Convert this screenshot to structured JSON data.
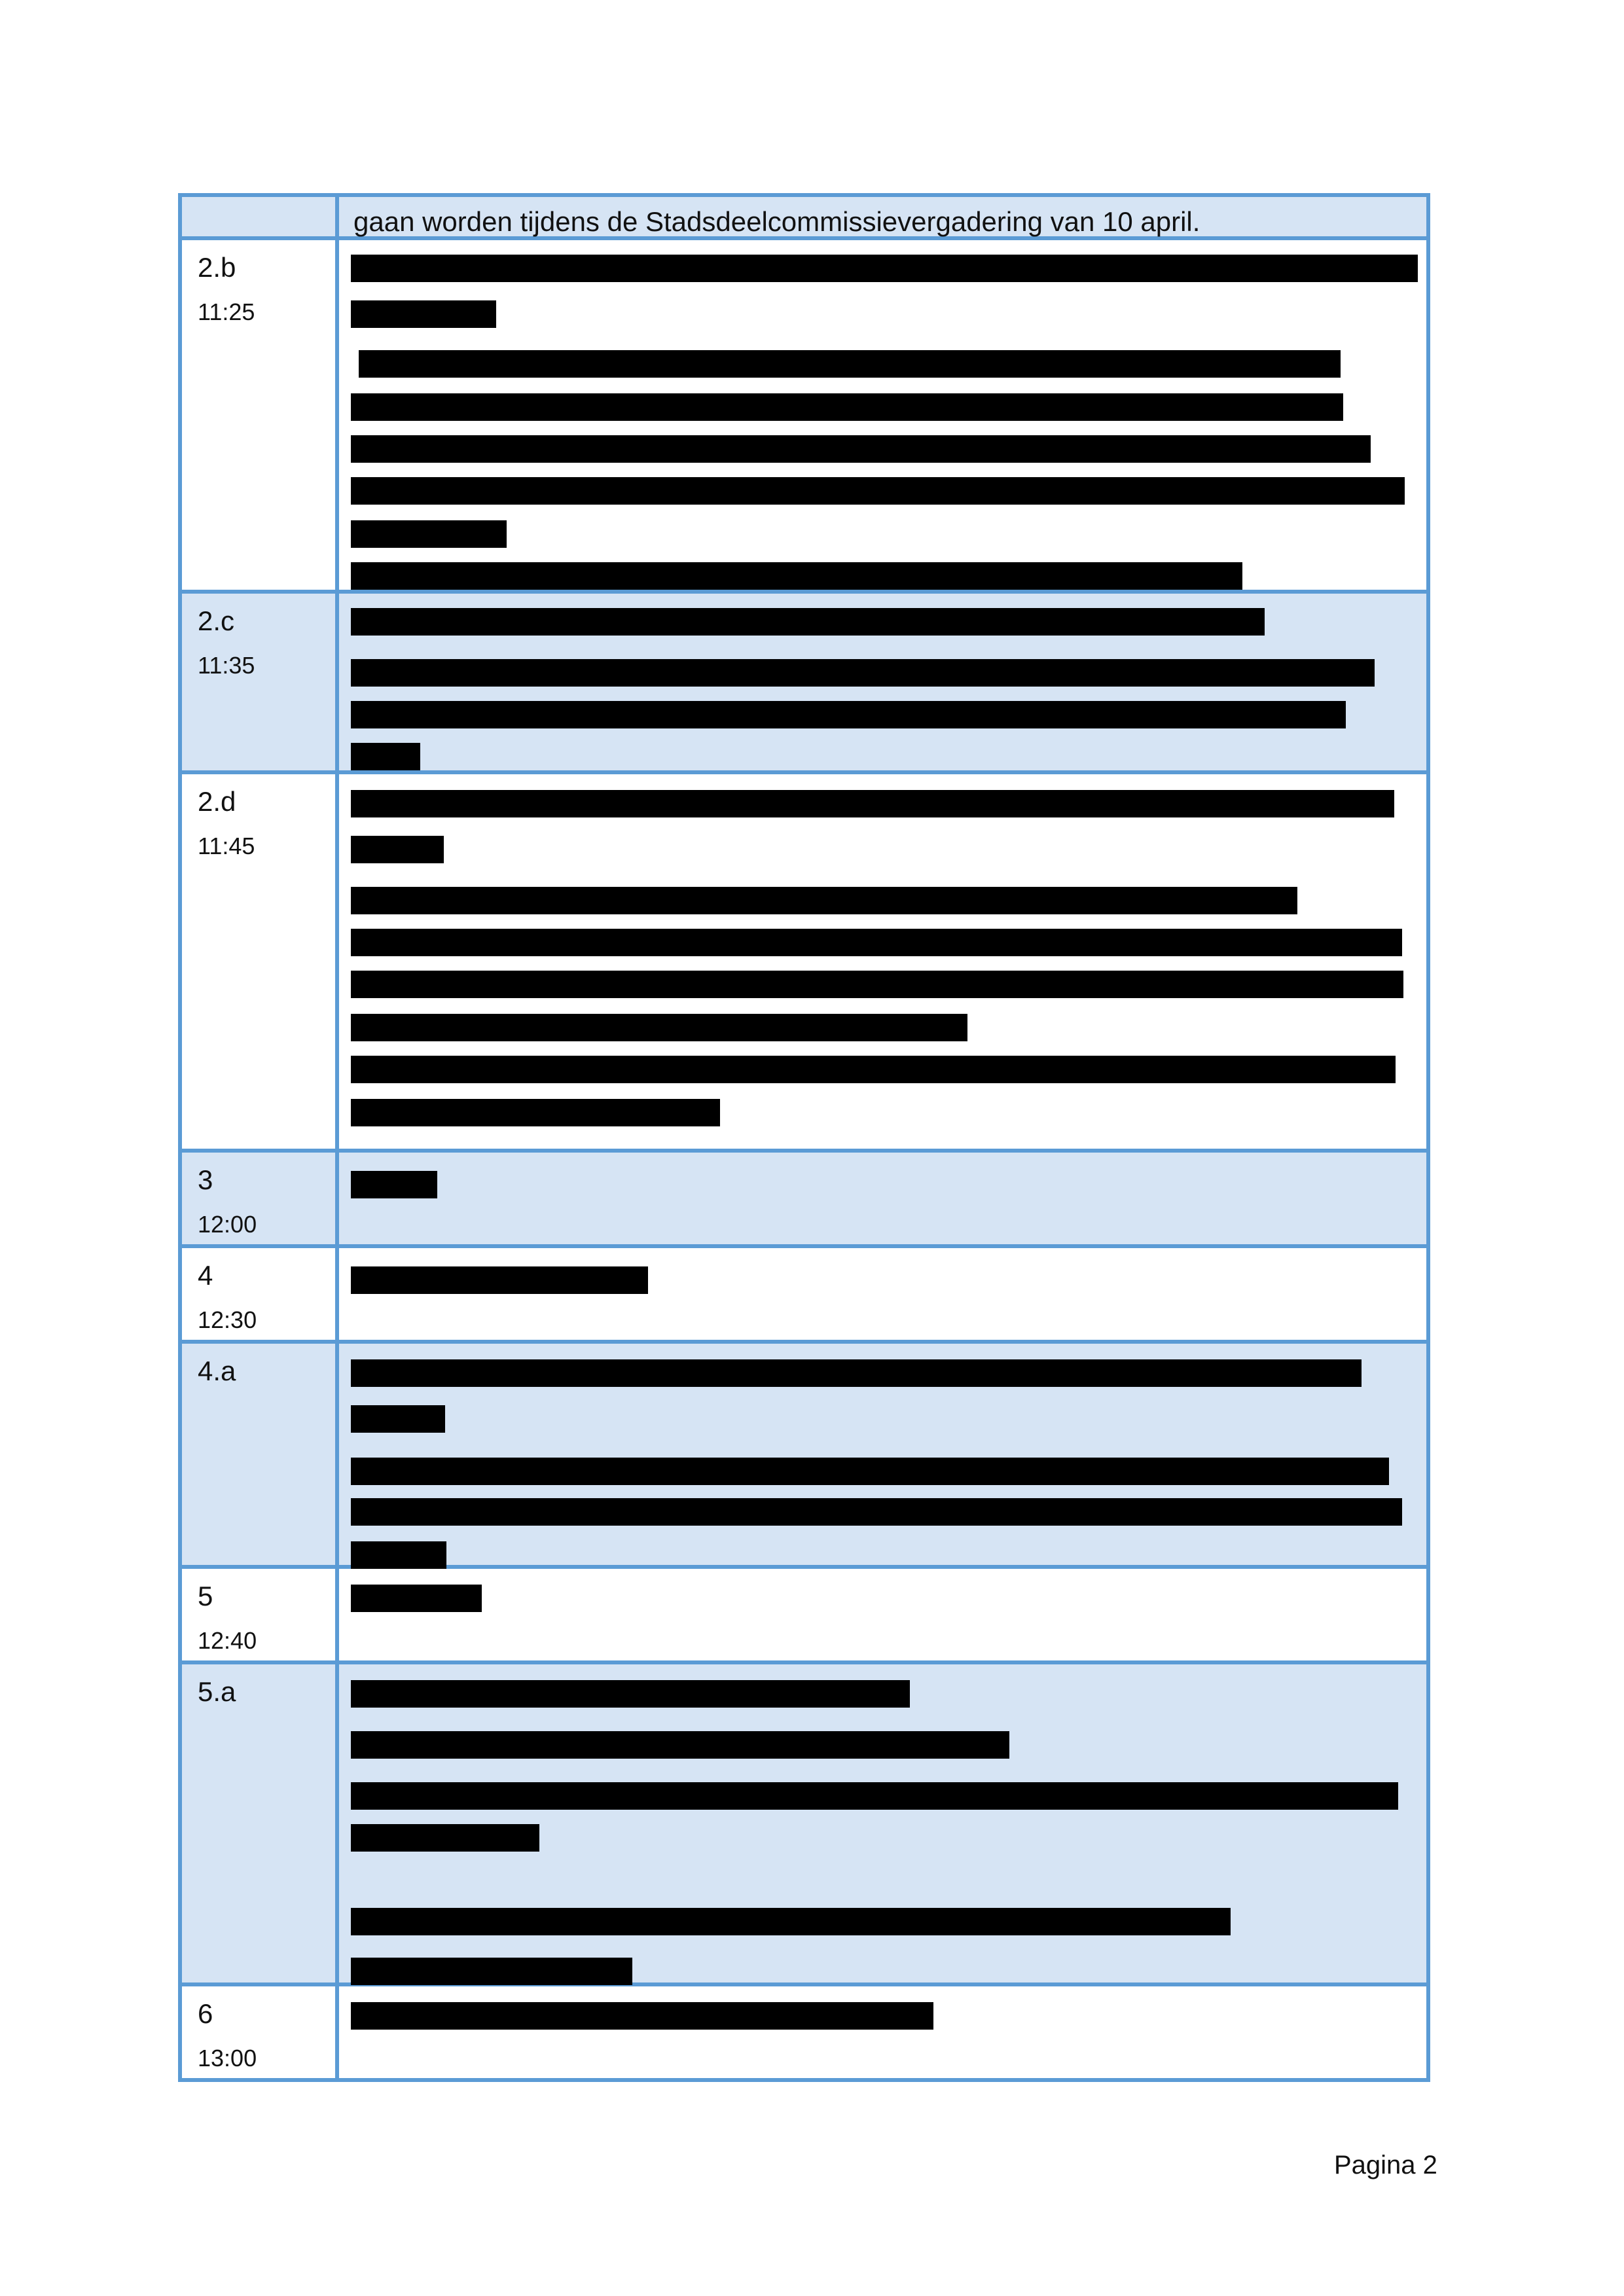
{
  "continuation_text": "gaan worden tijdens de Stadsdeelcommissievergadering van 10 april.",
  "items": [
    {
      "num": "2.b",
      "time": "11:25"
    },
    {
      "num": "2.c",
      "time": "11:35"
    },
    {
      "num": "2.d",
      "time": "11:45"
    },
    {
      "num": "3",
      "time": "12:00"
    },
    {
      "num": "4",
      "time": "12:30"
    },
    {
      "num": "4.a",
      "time": ""
    },
    {
      "num": "5",
      "time": "12:40"
    },
    {
      "num": "5.a",
      "time": ""
    },
    {
      "num": "6",
      "time": "13:00"
    }
  ],
  "footer": {
    "page_label": "Pagina 2"
  },
  "colors": {
    "border": "#5b9bd5",
    "shade": "#d6e4f4",
    "redaction": "#000000"
  }
}
